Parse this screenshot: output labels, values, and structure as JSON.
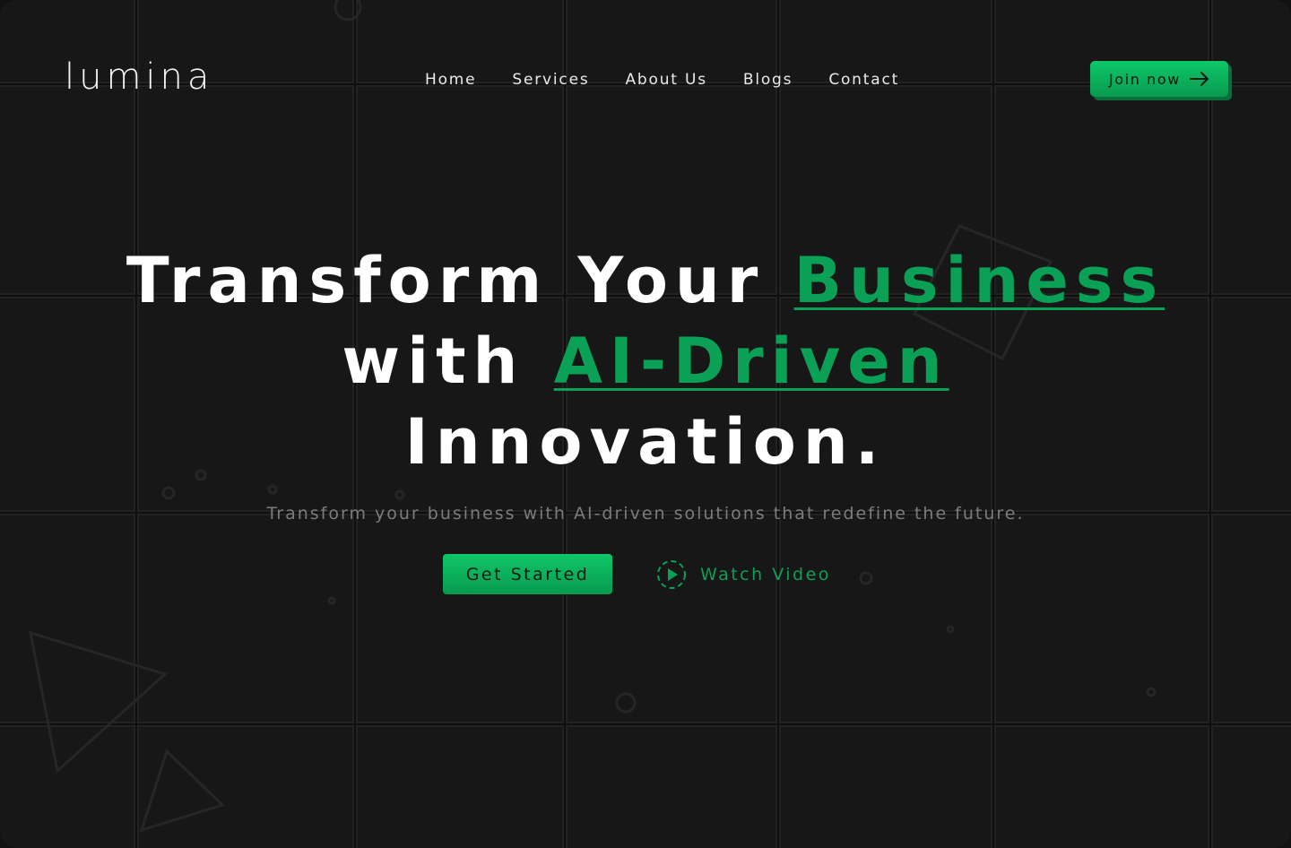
{
  "brand": {
    "logo": "lumina"
  },
  "nav": {
    "items": [
      {
        "label": "Home"
      },
      {
        "label": "Services"
      },
      {
        "label": "About Us"
      },
      {
        "label": "Blogs"
      },
      {
        "label": "Contact"
      }
    ]
  },
  "header": {
    "cta_label": "Join now",
    "cta_icon": "arrow-right-icon"
  },
  "hero": {
    "headline": {
      "part1": "Transform Your ",
      "accent1": "Business",
      "part2": "with ",
      "accent2": "AI-Driven",
      "part3": "Innovation."
    },
    "subtitle": "Transform your business with AI-driven solutions that redefine the future.",
    "primary_cta": "Get Started",
    "secondary_cta": "Watch Video",
    "secondary_icon": "play-circle-icon"
  },
  "colors": {
    "background": "#171717",
    "accent": "#0aa055",
    "button_gradient_top": "#0fc769",
    "button_gradient_bottom": "#089a50",
    "text": "#ffffff",
    "muted_text": "#7c7c7c"
  }
}
